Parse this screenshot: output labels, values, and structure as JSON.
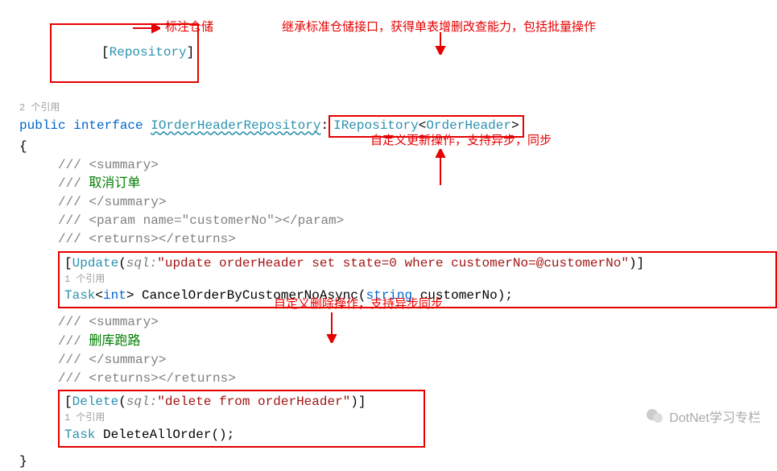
{
  "attribute_repo": "Repository",
  "references_2": "2 个引用",
  "references_1a": "1 个引用",
  "references_1b": "1 个引用",
  "kw_public": "public",
  "kw_interface": "interface",
  "iface_name": "IOrderHeaderRepository",
  "base_name": "IRepository",
  "generic_arg": "OrderHeader",
  "brace_open": "{",
  "brace_close": "}",
  "xml_summary_open": "/// <summary>",
  "xml_summary_close": "/// </summary>",
  "xml_cancel_comment": "/// 取消订单",
  "xml_param": "/// <param name=\"customerNo\"></param>",
  "xml_returns": "/// <returns></returns>",
  "update_attr": "Update",
  "sql_label": "sql:",
  "update_sql": "\"update orderHeader set state=0 where customerNo=@customerNo\"",
  "task": "Task",
  "int_kw": "int",
  "cancel_method": "CancelOrderByCustomerNoAsync",
  "string_kw": "string",
  "param_name": "customerNo",
  "xml_delete_comment": "/// 删库跑路",
  "delete_attr": "Delete",
  "delete_sql": "\"delete from orderHeader\"",
  "delete_method": "DeleteAllOrder",
  "anno_repo": "标注仓储",
  "anno_inherit": "继承标准仓储接口，获得单表增删改查能力，包括批量操作",
  "anno_update": "自定义更新操作，支持异步，同步",
  "anno_delete": "自定义删除操作，支持异步同步",
  "watermark": "DotNet学习专栏"
}
